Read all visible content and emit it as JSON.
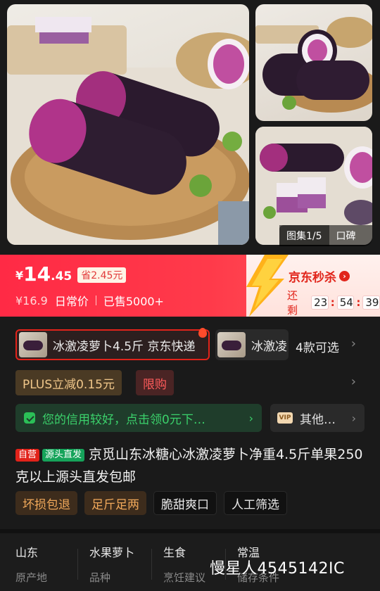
{
  "gallery": {
    "counter_label": "图集1/5",
    "review_label": "口碑"
  },
  "price": {
    "currency": "¥",
    "integer": "14",
    "decimal": ".45",
    "saving": "省2.45元",
    "original": "¥16.9",
    "original_label": "日常价",
    "sold": "已售5000+"
  },
  "flash_sale": {
    "title": "京东秒杀",
    "remaining_label": "还剩",
    "hours": "23",
    "minutes": "54",
    "seconds": "39"
  },
  "variants": {
    "selected_label": "冰激凌萝卜4.5斤 京东快递",
    "other_label": "冰激凌",
    "count_label": "4款可选"
  },
  "promos": {
    "plus": "PLUS立减0.15元",
    "limit": "限购",
    "credit_text": "您的信用较好，点击领0元下…",
    "other_text": "其他…",
    "vip_icon_text": "VIP"
  },
  "product": {
    "tag_self": "自营",
    "tag_direct": "源头直发",
    "title": "京觅山东冰糖心冰激凌萝卜净重4.5斤单果250克以上源头直发包邮",
    "features": [
      "坏损包退",
      "足斤足两",
      "脆甜爽口",
      "人工筛选"
    ]
  },
  "specs": [
    {
      "value": "山东",
      "key": "原产地"
    },
    {
      "value": "水果萝卜",
      "key": "品种"
    },
    {
      "value": "生食",
      "key": "烹饪建议"
    },
    {
      "value": "常温",
      "key": "储存条件"
    }
  ],
  "watermark": "慢星人4545142IC",
  "colors": {
    "brand_red": "#e2231a",
    "price_band": "#ff2a45",
    "credit_green": "#3bd16b"
  }
}
